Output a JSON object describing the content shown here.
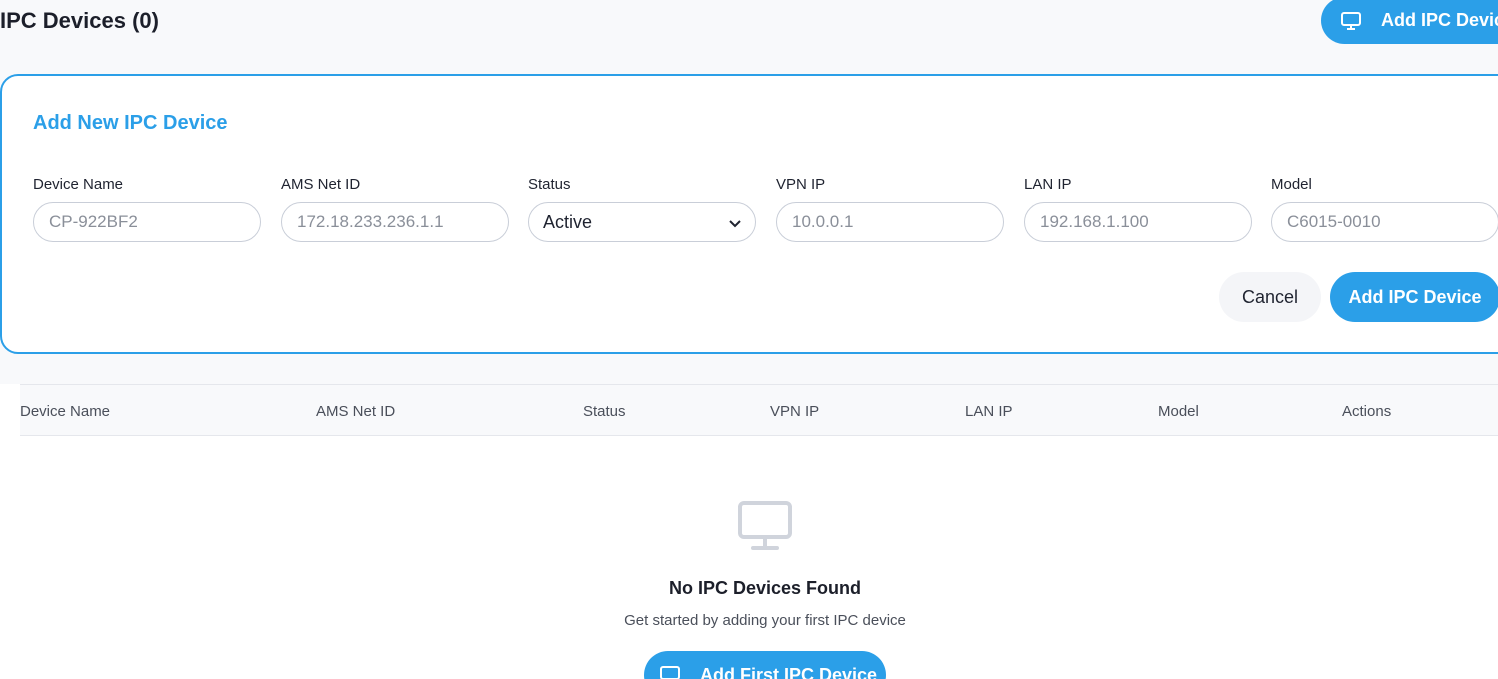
{
  "header": {
    "title": "IPC Devices (0)",
    "add_button_label": "Add IPC Device"
  },
  "form": {
    "title": "Add New IPC Device",
    "fields": [
      {
        "label": "Device Name",
        "placeholder": "CP-922BF2"
      },
      {
        "label": "AMS Net ID",
        "placeholder": "172.18.233.236.1.1"
      },
      {
        "label": "Status",
        "value": "Active"
      },
      {
        "label": "VPN IP",
        "placeholder": "10.0.0.1"
      },
      {
        "label": "LAN IP",
        "placeholder": "192.168.1.100"
      },
      {
        "label": "Model",
        "placeholder": "C6015-0010"
      }
    ],
    "cancel_label": "Cancel",
    "submit_label": "Add IPC Device"
  },
  "table": {
    "columns": [
      "Device Name",
      "AMS Net ID",
      "Status",
      "VPN IP",
      "LAN IP",
      "Model",
      "Actions"
    ]
  },
  "empty_state": {
    "title": "No IPC Devices Found",
    "subtitle": "Get started by adding your first IPC device",
    "button_label": "Add First IPC Device"
  },
  "colors": {
    "accent": "#2b9fe8",
    "background": "#f8f9fb"
  }
}
